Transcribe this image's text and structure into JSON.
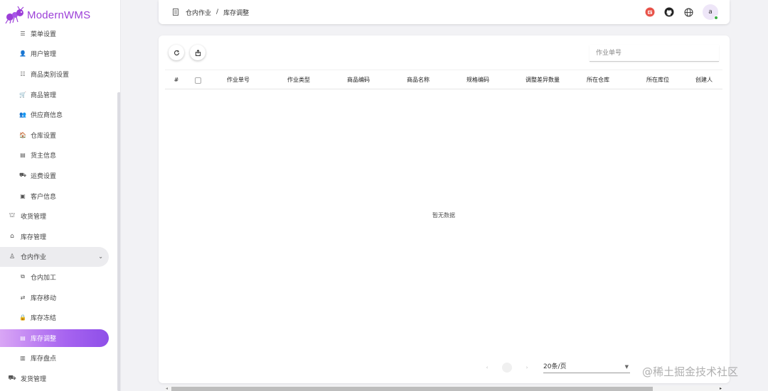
{
  "brand": {
    "name": "ModernWMS",
    "accent": "#9c3fd8"
  },
  "sidebar": {
    "items": [
      {
        "label": "菜单设置",
        "icon": "list-icon",
        "glyph": "☰",
        "level": "sub"
      },
      {
        "label": "用户管理",
        "icon": "user-icon",
        "glyph": "👤",
        "level": "sub"
      },
      {
        "label": "商品类别设置",
        "icon": "category-icon",
        "glyph": "☷",
        "level": "sub"
      },
      {
        "label": "商品管理",
        "icon": "cart-icon",
        "glyph": "🛒",
        "level": "sub"
      },
      {
        "label": "供应商信息",
        "icon": "supplier-icon",
        "glyph": "👥",
        "level": "sub"
      },
      {
        "label": "仓库设置",
        "icon": "warehouse-icon",
        "glyph": "🏠",
        "level": "sub"
      },
      {
        "label": "货主信息",
        "icon": "owner-card-icon",
        "glyph": "▤",
        "level": "sub"
      },
      {
        "label": "运费设置",
        "icon": "freight-icon",
        "glyph": "⛟",
        "level": "sub"
      },
      {
        "label": "客户信息",
        "icon": "customer-icon",
        "glyph": "▣",
        "level": "sub"
      },
      {
        "label": "收货管理",
        "icon": "receiving-icon",
        "glyph": "⛫",
        "level": "top"
      },
      {
        "label": "库存管理",
        "icon": "stock-icon",
        "glyph": "⌂",
        "level": "top"
      },
      {
        "label": "仓内作业",
        "icon": "warehouse-ops-icon",
        "glyph": "♙",
        "level": "top",
        "open": true
      },
      {
        "label": "仓内加工",
        "icon": "processing-icon",
        "glyph": "⧉",
        "level": "sub"
      },
      {
        "label": "库存移动",
        "icon": "move-icon",
        "glyph": "⇄",
        "level": "sub"
      },
      {
        "label": "库存冻结",
        "icon": "freeze-icon",
        "glyph": "🔒",
        "level": "sub"
      },
      {
        "label": "库存调整",
        "icon": "adjust-icon",
        "glyph": "▤",
        "level": "sub",
        "active": true
      },
      {
        "label": "库存盘点",
        "icon": "count-icon",
        "glyph": "▥",
        "level": "sub"
      },
      {
        "label": "发货管理",
        "icon": "shipping-icon",
        "glyph": "⛟",
        "level": "top"
      }
    ]
  },
  "header": {
    "breadcrumb": [
      "仓内作业",
      "库存调整"
    ],
    "breadcrumb_sep": "/",
    "avatar_letter": "a"
  },
  "toolbar": {
    "search_placeholder": "作业单号"
  },
  "table": {
    "columns": [
      "#",
      "作业单号",
      "作业类型",
      "商品编码",
      "商品名称",
      "规格编码",
      "调整差异数量",
      "所在仓库",
      "所在库位",
      "创建人"
    ],
    "empty_text": "暂无数据"
  },
  "pager": {
    "page_size": "20条/页"
  },
  "watermark": "@稀土掘金技术社区",
  "colors": {
    "active_gradient_start": "#d9a6f5",
    "active_gradient_end": "#8e4fe8",
    "online": "#3cb043"
  }
}
